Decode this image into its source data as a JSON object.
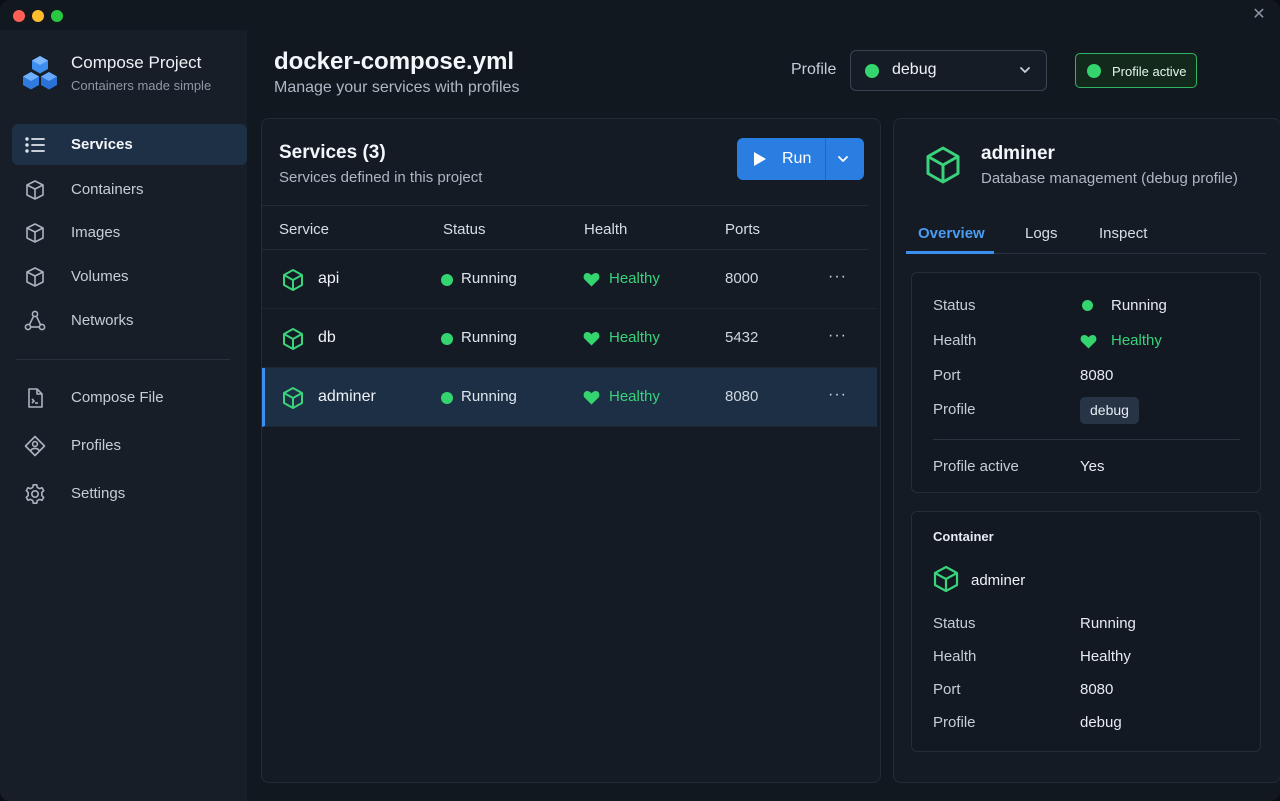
{
  "colors": {
    "accent": "#2a7de1",
    "success": "#34d46e",
    "background": "#121820",
    "sidebar": "#171e27"
  },
  "brand": {
    "title": "Compose Project",
    "subtitle": "Containers made simple",
    "logo": "stacked-cubes-logo"
  },
  "sidebar": {
    "items": [
      {
        "label": "Services",
        "icon": "list-icon",
        "active": true
      },
      {
        "label": "Containers",
        "icon": "box-icon",
        "active": false
      },
      {
        "label": "Images",
        "icon": "image-cube-icon",
        "active": false
      },
      {
        "label": "Volumes",
        "icon": "volume-cube-icon",
        "active": false
      },
      {
        "label": "Networks",
        "icon": "network-icon",
        "active": false
      },
      {
        "label": "Compose File",
        "icon": "file-icon",
        "active": false
      },
      {
        "label": "Profiles",
        "icon": "profile-icon",
        "active": false
      },
      {
        "label": "Settings",
        "icon": "gear-icon",
        "active": false
      }
    ]
  },
  "header": {
    "title": "docker-compose.yml",
    "subtitle": "Manage your services with profiles",
    "profile_label": "Profile",
    "profile_value": "debug",
    "profile_badge": "Profile active"
  },
  "services": {
    "title": "Services (3)",
    "subtitle": "Services defined in this project",
    "run_label": "Run",
    "columns": [
      "Service",
      "Status",
      "Health",
      "Ports"
    ],
    "rows": [
      {
        "name": "api",
        "status": "Running",
        "health": "Healthy",
        "port": "8000",
        "more": "···"
      },
      {
        "name": "db",
        "status": "Running",
        "health": "Healthy",
        "port": "5432",
        "more": "···"
      },
      {
        "name": "adminer",
        "status": "Running",
        "health": "Healthy",
        "port": "8080",
        "more": "···"
      }
    ]
  },
  "detail": {
    "title": "adminer",
    "subtitle": "Database management (debug profile)",
    "tabs": [
      "Overview",
      "Logs",
      "Inspect"
    ],
    "overview": {
      "status_key": "Status",
      "status_val": "Running",
      "health_key": "Health",
      "health_val": "Healthy",
      "port_key": "Port",
      "port_val": "8080",
      "profile_key": "Profile",
      "profile_val": "debug",
      "active_key": "Profile active",
      "active_val": "Yes"
    },
    "container": {
      "title": "Container",
      "name": "adminer",
      "status_key": "Status",
      "status_val": "Running",
      "health_key": "Health",
      "health_val": "Healthy",
      "port_key": "Port",
      "port_val": "8080",
      "profile_key": "Profile",
      "profile_val": "debug"
    }
  },
  "window": {
    "close_glyph": "✕"
  }
}
